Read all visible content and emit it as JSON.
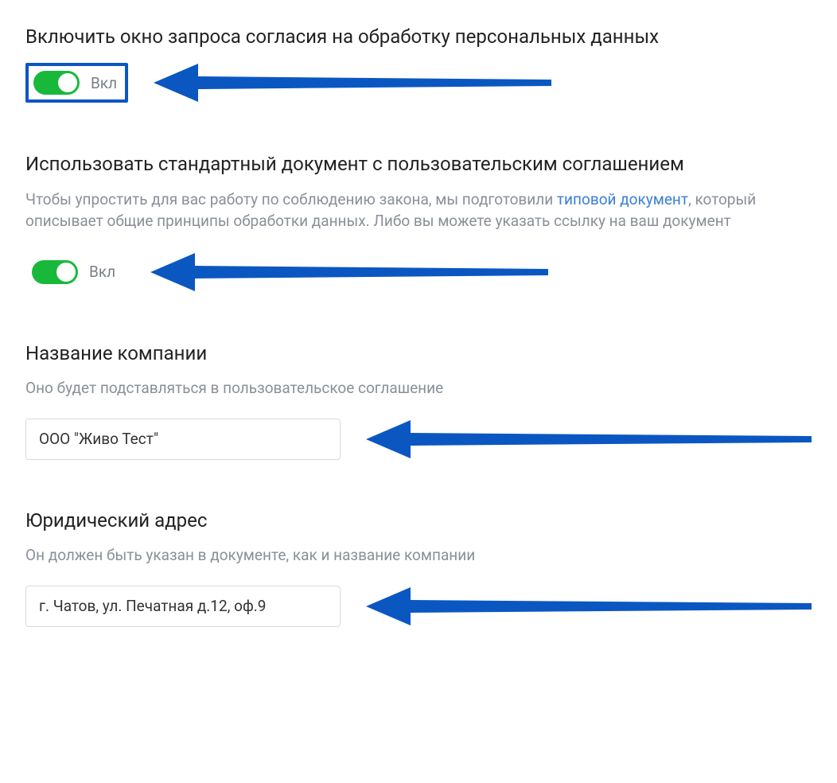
{
  "consent_toggle": {
    "heading": "Включить окно запроса согласия на обработку персональных данных",
    "label": "Вкл",
    "on": true
  },
  "standard_doc_toggle": {
    "heading": "Использовать стандартный документ с пользовательским соглашением",
    "desc_pre": "Чтобы упростить для вас работу по соблюдению закона, мы подготовили ",
    "desc_link": "типовой документ",
    "desc_post": ", который описывает общие принципы обработки данных. Либо вы можете указать ссылку на ваш документ",
    "label": "Вкл",
    "on": true
  },
  "company_name": {
    "heading": "Название компании",
    "desc": "Оно будет подставляться в пользовательское соглашение",
    "value": "ООО \"Живо Тест\""
  },
  "legal_address": {
    "heading": "Юридический адрес",
    "desc": "Он должен быть указан в документе, как и название компании",
    "value": "г. Чатов, ул. Печатная д.12, оф.9"
  },
  "colors": {
    "toggle_on": "#18b93b",
    "arrow": "#0b57c2",
    "link": "#3b7fd6"
  }
}
